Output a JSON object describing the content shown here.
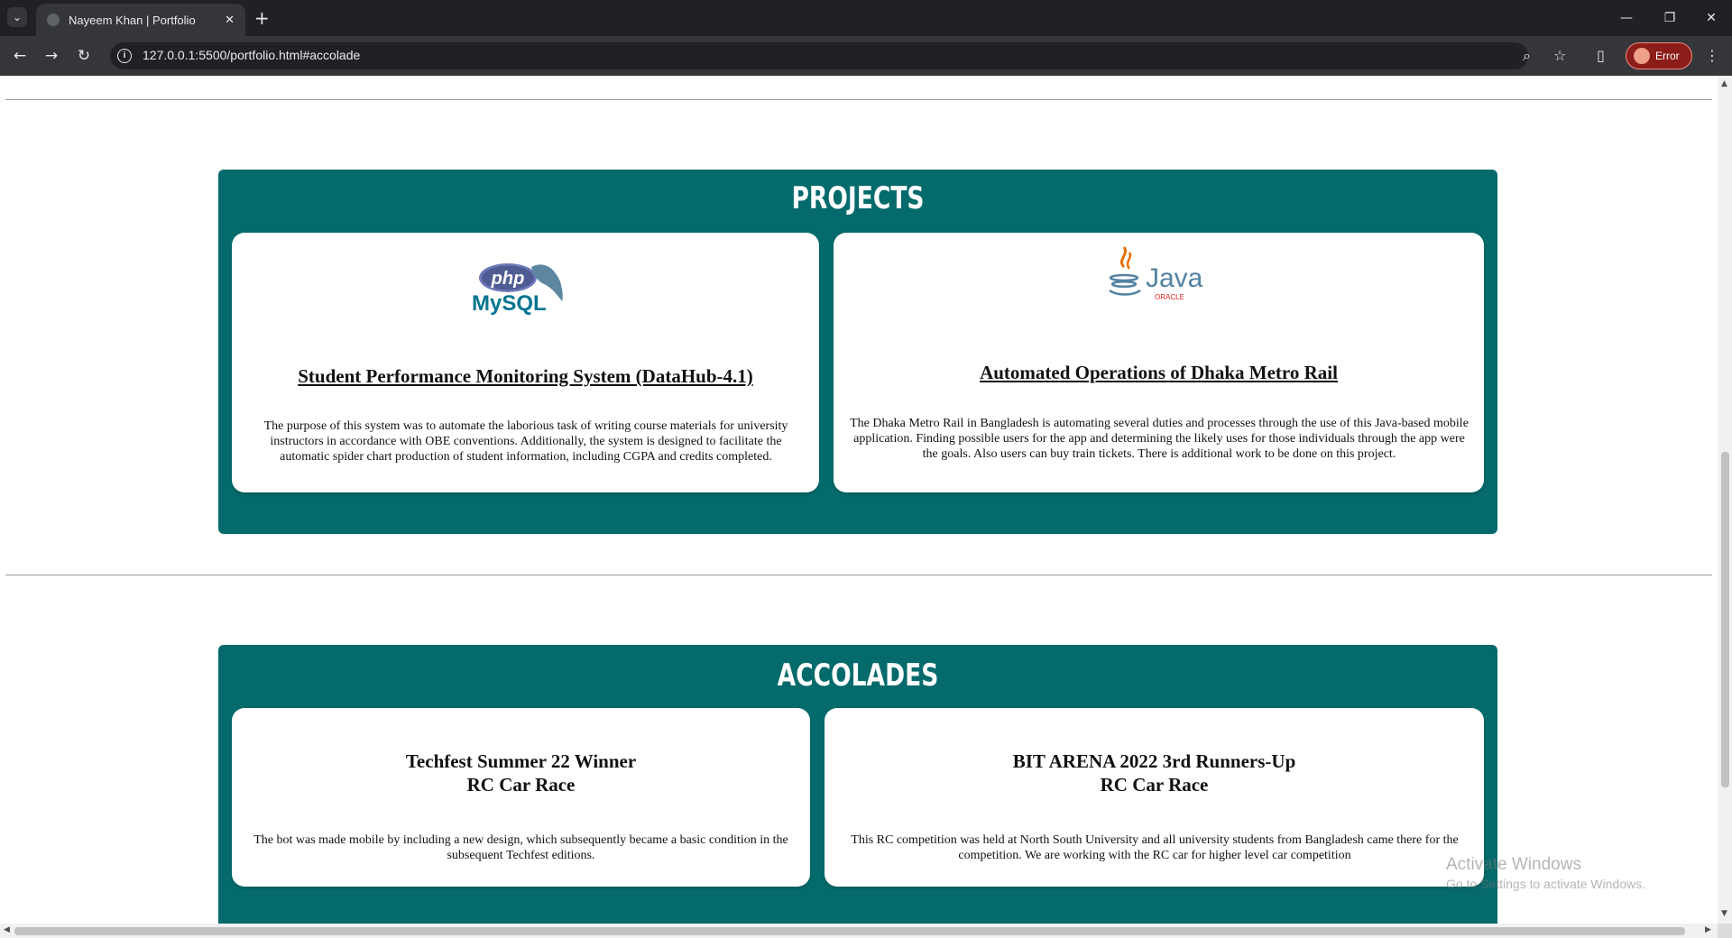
{
  "browser": {
    "tab_title": "Nayeem Khan | Portfolio",
    "tab_close": "✕",
    "new_tab": "+",
    "url": "127.0.0.1:5500/portfolio.html#accolade",
    "profile_label": "Error",
    "window_controls": {
      "minimize": "—",
      "restore": "❐",
      "close": "✕"
    },
    "nav": {
      "back": "←",
      "forward": "→",
      "reload": "↻",
      "info": "i",
      "zoom": "⌕",
      "bookmark": "☆",
      "sidepanel": "▯",
      "menu": "⋮",
      "tab_list": "⌄"
    }
  },
  "projects": {
    "heading": "PROJECTS",
    "items": [
      {
        "logo": "php-mysql-logo",
        "title": "Student Performance Monitoring System (DataHub-4.1)",
        "description": "The purpose of this system was to automate the laborious task of writing course materials for university instructors in accordance with OBE conventions. Additionally, the system is designed to facilitate the automatic spider chart production of student information, including CGPA and credits completed."
      },
      {
        "logo": "java-oracle-logo",
        "title": "Automated Operations of Dhaka Metro Rail",
        "description": "The Dhaka Metro Rail in Bangladesh is automating several duties and processes through the use of this Java-based mobile application. Finding possible users for the app and determining the likely uses for those individuals through the app were the goals. Also users can buy train tickets. There is additional work to be done on this project."
      }
    ],
    "logo_text": {
      "php": "php",
      "mysql": "MySQL",
      "java": "Java",
      "oracle": "ORACLE"
    }
  },
  "accolades": {
    "heading": "ACCOLADES",
    "items": [
      {
        "title_line1": "Techfest Summer 22 Winner",
        "title_line2": "RC Car Race",
        "description": "The bot was made mobile by including a new design, which subsequently became a basic condition in the subsequent Techfest editions."
      },
      {
        "title_line1": "BIT ARENA 2022 3rd Runners-Up",
        "title_line2": "RC Car Race",
        "description": "This RC competition was held at North South University and all university students from Bangladesh came there for the competition. We are working with the RC car for higher level car competition"
      }
    ]
  },
  "watermark": {
    "line1": "Activate Windows",
    "line2": "Go to Settings to activate Windows."
  },
  "colors": {
    "section_bg": "#046a6b",
    "chrome_bg": "#202124",
    "toolbar_bg": "#35363a"
  }
}
